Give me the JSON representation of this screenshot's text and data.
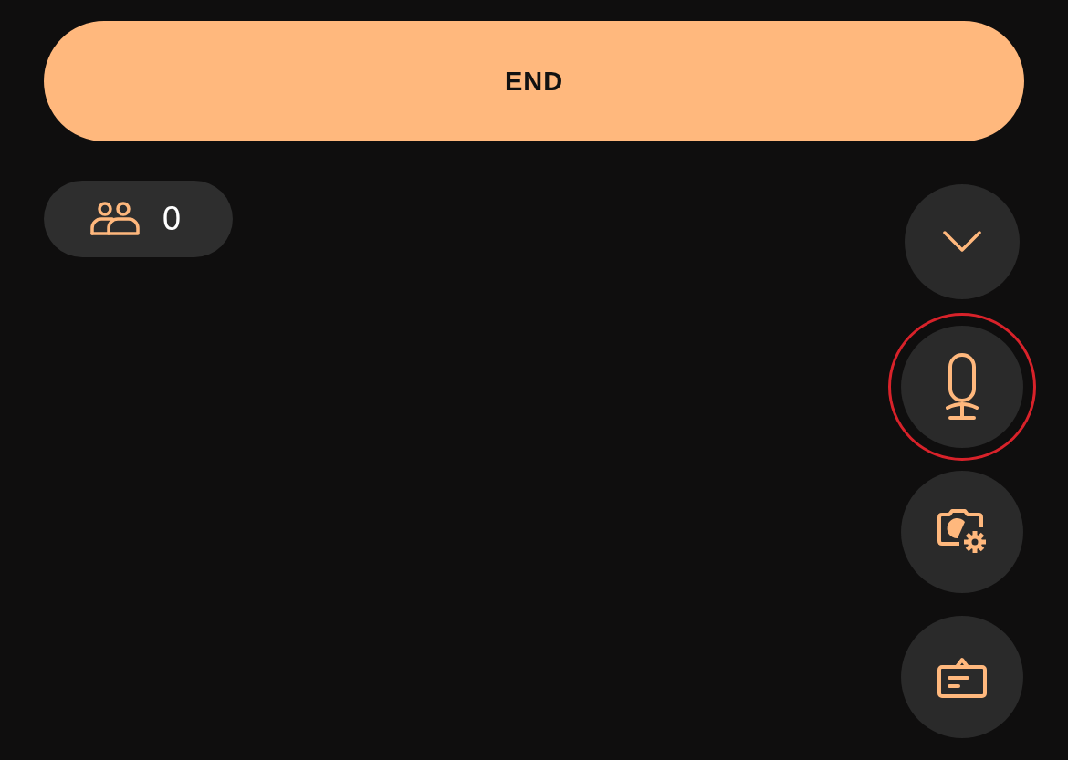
{
  "end_button": {
    "label": "END"
  },
  "viewer_count": {
    "count": "0"
  },
  "side_buttons": [
    {
      "kind": "collapse",
      "highlighted": false
    },
    {
      "kind": "microphone",
      "highlighted": true
    },
    {
      "kind": "camera-settings",
      "highlighted": false
    },
    {
      "kind": "caption",
      "highlighted": false
    }
  ]
}
